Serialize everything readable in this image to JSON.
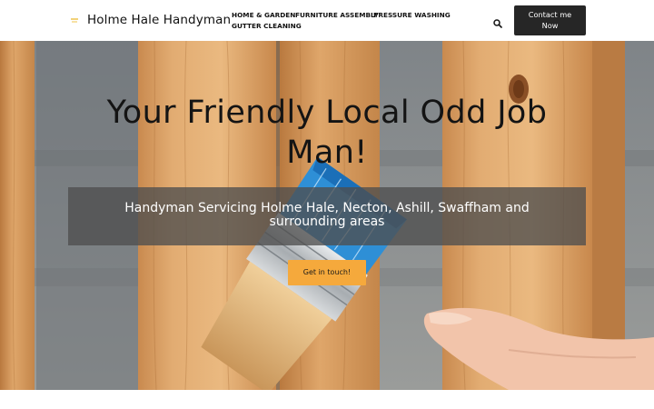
{
  "header": {
    "site_title": "Holme Hale Handyman",
    "logo_icon": "small-yellow-mark-icon",
    "nav": [
      "HOME & GARDEN",
      "FURNITURE ASSEMBLY",
      "PRESSURE WASHING",
      "GUTTER CLEANING"
    ],
    "search_icon": "search-icon",
    "contact_line1": "Contact me",
    "contact_line2": "Now"
  },
  "hero": {
    "title_line1": "Your Friendly Local Odd Job",
    "title_line2": "Man!",
    "subtitle_line1": "Handyman Servicing Holme Hale, Necton, Ashill, Swaffham and",
    "subtitle_line2": "surrounding areas",
    "cta_label": "Get in touch!",
    "background_image": "wooden-fence-with-blue-paintbrush"
  },
  "colors": {
    "accent": "#f5a93c",
    "contact_button": "#262626",
    "banner": "#4e4e4e",
    "brush_blue": "#2e8fd6"
  }
}
